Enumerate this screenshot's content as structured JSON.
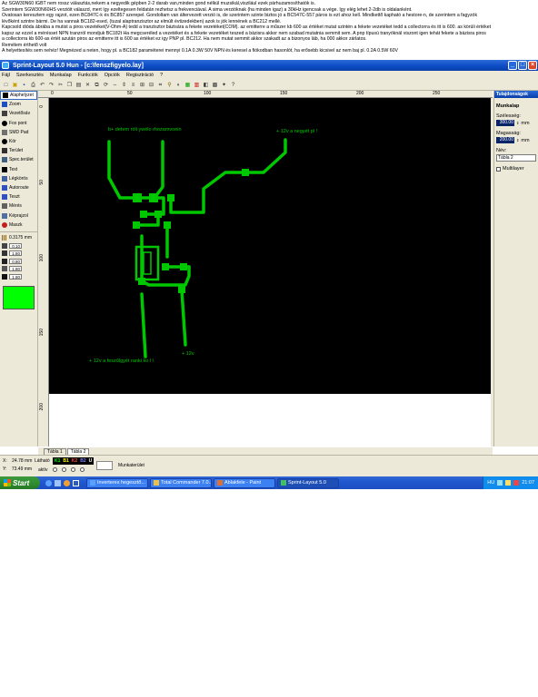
{
  "forum_text": [
    "Az SGW30N60 IGBT nem rossz választás,nekem a negyedik gépben 2-2 darab van,minden gond nélkül muzsikál,viszilául ezek párhuzamosíthatók is.",
    "Szerintem SGW30N60HS verzióit válaszd, mert így ezeltegesen feldatán rezhetsz a frekvenciával. A sima verzióknak (ha minden igaz) a 30kHz igencsak a vége. Így elég lehet 2-2db is oldalanként.",
    "Óvatosan keresztem egy rajzot, ezen BC847C-k és BC857 szerepel. Gondoltam van áltervezett verzió is, de szerintem szinte biztos jó a BC547C-557 páros is ezt ahoz kell. Mindkettő kapható a hestore-n, de szerintem a fagyzók",
    "lévőként szintre bármi. De ha vannak BC182-esed, (tuzal alaptranzisztor az elmúlt évtizedekben) azok is jók lennének a BC212 mellé.",
    "Kapcsold dióda ábrába a mutist a piros vezetéket(V-Ohm-A) tedd a tranzisztor bázisára a fekete vezetéket(COM). az emitterre a műszer kb 600 as értéket mutat szintén a fekete vezetéket tedd a collectorra és itt is 600. as körüli értéket",
    "kapsz az ezzel a mérésset NPN tranzról mondjuk BC182t Ha megcseréled a vezetéket és a fekete vezetéket teszed a bázisra akkor nem szabad mutatnia semmit sem. A pnp típusú tranyóknál viszont igen tehát fekete a bázisra piros",
    "a collectorra kb 600-as értét azután piros az emitterre itt is 600 as értéket ez igy PNP pl. BC212. Ha nem mutat semmit akkor szakadt az a bizonyos láb, ha 000 akkor zárlatos.",
    "Remélem érthető volt",
    "A helyettesítés sem nehéz! Megnézed a neten, hogy pl. a BC182 paraméterei mennyi 0.1A 0.3W 50V NPN és keresel a fiókodban hasonlót, ha erősebb kicsivel az nem baj pl. 0.2A 0.5W 60V"
  ],
  "window": {
    "title": "Sprint-Layout 5.0 Hun   - [c:\\fenszfigyelo.lay]"
  },
  "menu": [
    "Fájl",
    "Szerkesztés",
    "Munkalap",
    "Funkciók",
    "Opciók",
    "Regisztráció",
    "?"
  ],
  "tools": [
    {
      "label": "Alaphelyzet",
      "icon": "pointer-icon",
      "color": "#000000"
    },
    {
      "label": "Zoom",
      "icon": "zoom-icon",
      "color": "#2050c0"
    },
    {
      "label": "Vezetősáv",
      "icon": "track-icon",
      "color": "#404040"
    },
    {
      "label": "Fox pont",
      "icon": "pad-icon",
      "color": "#000000"
    },
    {
      "label": "SMD Pad",
      "icon": "smd-pad-icon",
      "color": "#707070"
    },
    {
      "label": "Kör",
      "icon": "circle-icon",
      "color": "#000000"
    },
    {
      "label": "Terület",
      "icon": "area-icon",
      "color": "#303030"
    },
    {
      "label": "Spec.terület",
      "icon": "special-area-icon",
      "color": "#406080"
    },
    {
      "label": "Text",
      "icon": "text-icon",
      "color": "#000000"
    },
    {
      "label": "Légkörös",
      "icon": "airwire-icon",
      "color": "#4060a0"
    },
    {
      "label": "Autoroute",
      "icon": "autoroute-icon",
      "color": "#3050c0"
    },
    {
      "label": "Teszt",
      "icon": "test-icon",
      "color": "#3050c0"
    },
    {
      "label": "Mérés",
      "icon": "measure-icon",
      "color": "#606060"
    },
    {
      "label": "Képrajzol",
      "icon": "photo-icon",
      "color": "#5070a0"
    },
    {
      "label": "Maszk",
      "icon": "mask-icon",
      "color": "#c02020"
    }
  ],
  "grid": {
    "value": "0.3175 mm"
  },
  "track_widths": [
    "0.10",
    "1.80",
    "0.80",
    "1.80",
    "1.80"
  ],
  "active_layer_color": "#00ff00",
  "ruler": {
    "top": [
      "0",
      "50",
      "100",
      "150",
      "200",
      "250"
    ],
    "left": [
      "0",
      "50",
      "100",
      "150",
      "200"
    ]
  },
  "pcb": {
    "labels": [
      "b+ detem róli ywélo rhozamvoein",
      "+ 12v a negyét pl !",
      "+ 12v a feszűlgyét  ranki ko l l",
      "+ 12v"
    ],
    "track_color": "#00c800",
    "text_color": "#00c800"
  },
  "props": {
    "header": "Tulajdonságok",
    "section": "Munkalap",
    "width_label": "Szélesség:",
    "width_value": "300.00",
    "height_label": "Magasság:",
    "height_value": "200.00",
    "unit": "mm",
    "name_label": "Név:",
    "name_value": "Tábla 2",
    "multilayer_label": "Multilayer"
  },
  "sheets": [
    {
      "label": "Tábla 1"
    },
    {
      "label": "Tábla 2"
    }
  ],
  "status": {
    "x_label": "X:",
    "x_value": "24.78 mm",
    "y_label": "Y:",
    "y_value": "73.49 mm",
    "visible_label": "Látható",
    "layers": [
      "K1",
      "B1",
      "K2",
      "B2",
      "U"
    ],
    "active_label": "aktív",
    "worksurface_label": "Munkaterület"
  },
  "taskbar": {
    "start": "Start",
    "tasks": [
      {
        "label": "Inverteres hegesztő..."
      },
      {
        "label": "Total Commander 7.0..."
      },
      {
        "label": "Ablakfele - Paint"
      },
      {
        "label": "Sprint-Layout 5.0"
      }
    ],
    "lang": "HU",
    "clock": "21:07"
  }
}
